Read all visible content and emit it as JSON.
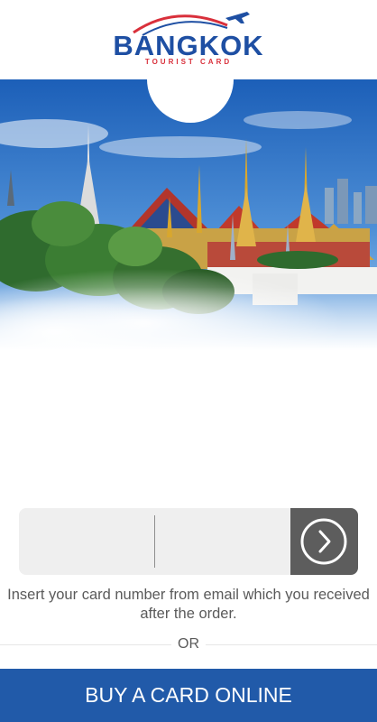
{
  "logo": {
    "brand": "BANGKOK",
    "tagline": "TOURIST CARD",
    "arc_color": "#d9303b",
    "plane_color": "#1e4fa3"
  },
  "hero": {
    "icon": "grand-palace-illustration"
  },
  "card_input": {
    "part1_value": "",
    "part2_value": "",
    "submit_icon": "chevron-right-circle-icon"
  },
  "hint_text": "Insert your card number from email which you received after the order.",
  "or_label": "OR",
  "buy_button_label": "BUY A CARD ONLINE",
  "colors": {
    "primary_blue": "#215aa9",
    "submit_gray": "#5d5d5d",
    "input_bg": "#efefef"
  }
}
